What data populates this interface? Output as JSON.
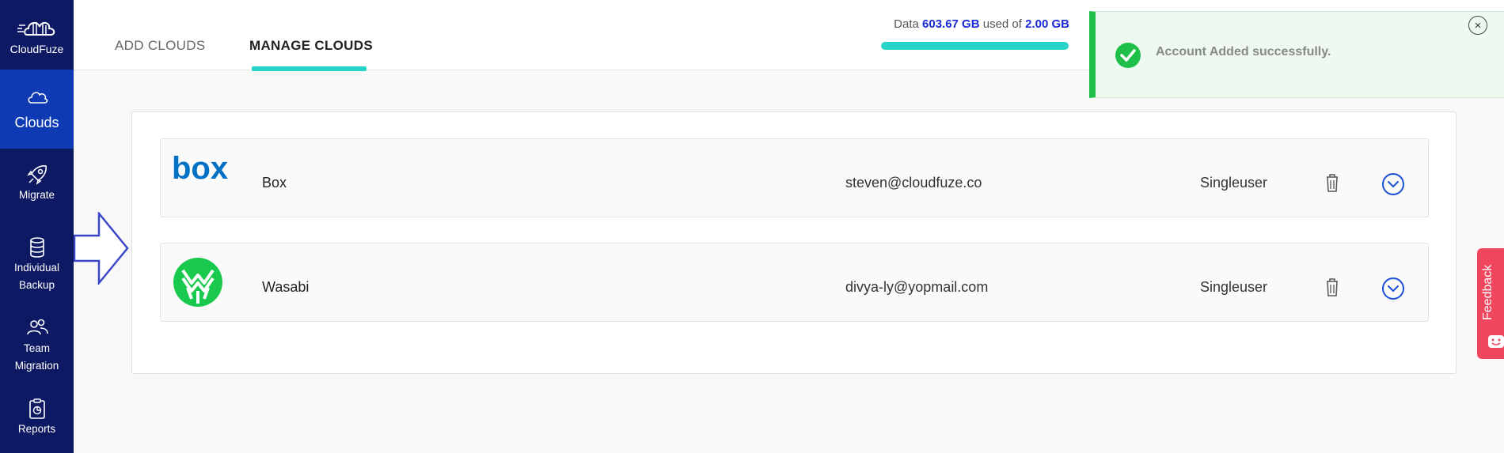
{
  "sidebar": {
    "logo_text": "CloudFuze",
    "items": [
      {
        "label": "Clouds",
        "icon": "cloud-icon"
      },
      {
        "label": "Migrate",
        "icon": "rocket-icon"
      },
      {
        "label_line1": "Individual",
        "label_line2": "Backup",
        "icon": "database-icon"
      },
      {
        "label_line1": "Team",
        "label_line2": "Migration",
        "icon": "users-icon"
      },
      {
        "label": "Reports",
        "icon": "clipboard-icon"
      }
    ]
  },
  "header": {
    "tabs": [
      {
        "label": "ADD CLOUDS",
        "active": false
      },
      {
        "label": "MANAGE CLOUDS",
        "active": true
      }
    ],
    "usage": {
      "prefix": "Data",
      "used": "603.67 GB",
      "middle": "used of",
      "total": "2.00 GB",
      "progress": 1.0
    }
  },
  "toast": {
    "message": "Account Added successfully.",
    "close_symbol": "×"
  },
  "clouds": [
    {
      "provider": "Box",
      "email": "steven@cloudfuze.co",
      "type": "Singleuser"
    },
    {
      "provider": "Wasabi",
      "email": "divya-ly@yopmail.com",
      "type": "Singleuser"
    }
  ],
  "feedback": {
    "label": "Feedback"
  },
  "colors": {
    "sidebar": "#0d1a63",
    "sidebar_active": "#0e3ab4",
    "accent_teal": "#28d4c9",
    "success": "#1fc04a",
    "feedback": "#f0475e",
    "link_blue": "#1b2ad6"
  }
}
